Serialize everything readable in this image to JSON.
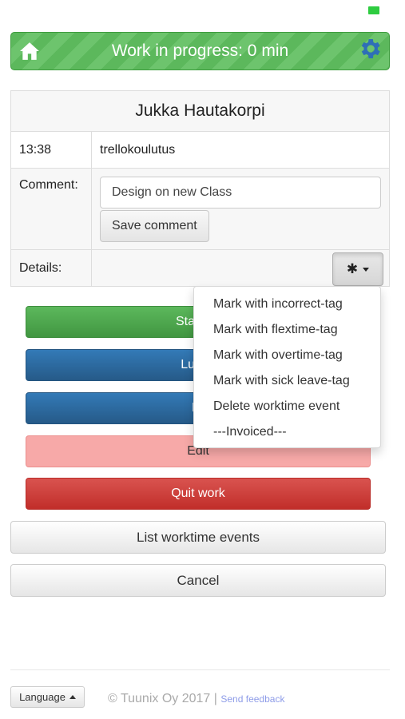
{
  "header": {
    "title": "Work in progress: 0 min"
  },
  "user": {
    "name": "Jukka Hautakorpi"
  },
  "event": {
    "time": "13:38",
    "name": "trellokoulutus"
  },
  "comment": {
    "label": "Comment:",
    "value": "Design on new Class",
    "save_label": "Save comment"
  },
  "details": {
    "label": "Details:",
    "toggle_icon": "✱"
  },
  "actions": {
    "start": "Start ne",
    "lunch": "Lunch",
    "break": "Br",
    "edit": "Edit",
    "quit": "Quit work",
    "list": "List worktime events",
    "cancel": "Cancel"
  },
  "dropdown": {
    "items": [
      "Mark with incorrect-tag",
      "Mark with flextime-tag",
      "Mark with overtime-tag",
      "Mark with sick leave-tag",
      "Delete worktime event",
      "---Invoiced---"
    ]
  },
  "footer": {
    "language": "Language",
    "copyright": "© Tuunix Oy  2017",
    "separator": "|",
    "feedback": "Send feedback"
  },
  "colors": {
    "header_green": "#5cb85c",
    "primary_blue": "#337ab7",
    "danger_red": "#d9534f",
    "gear_blue": "#2e6fb7"
  }
}
